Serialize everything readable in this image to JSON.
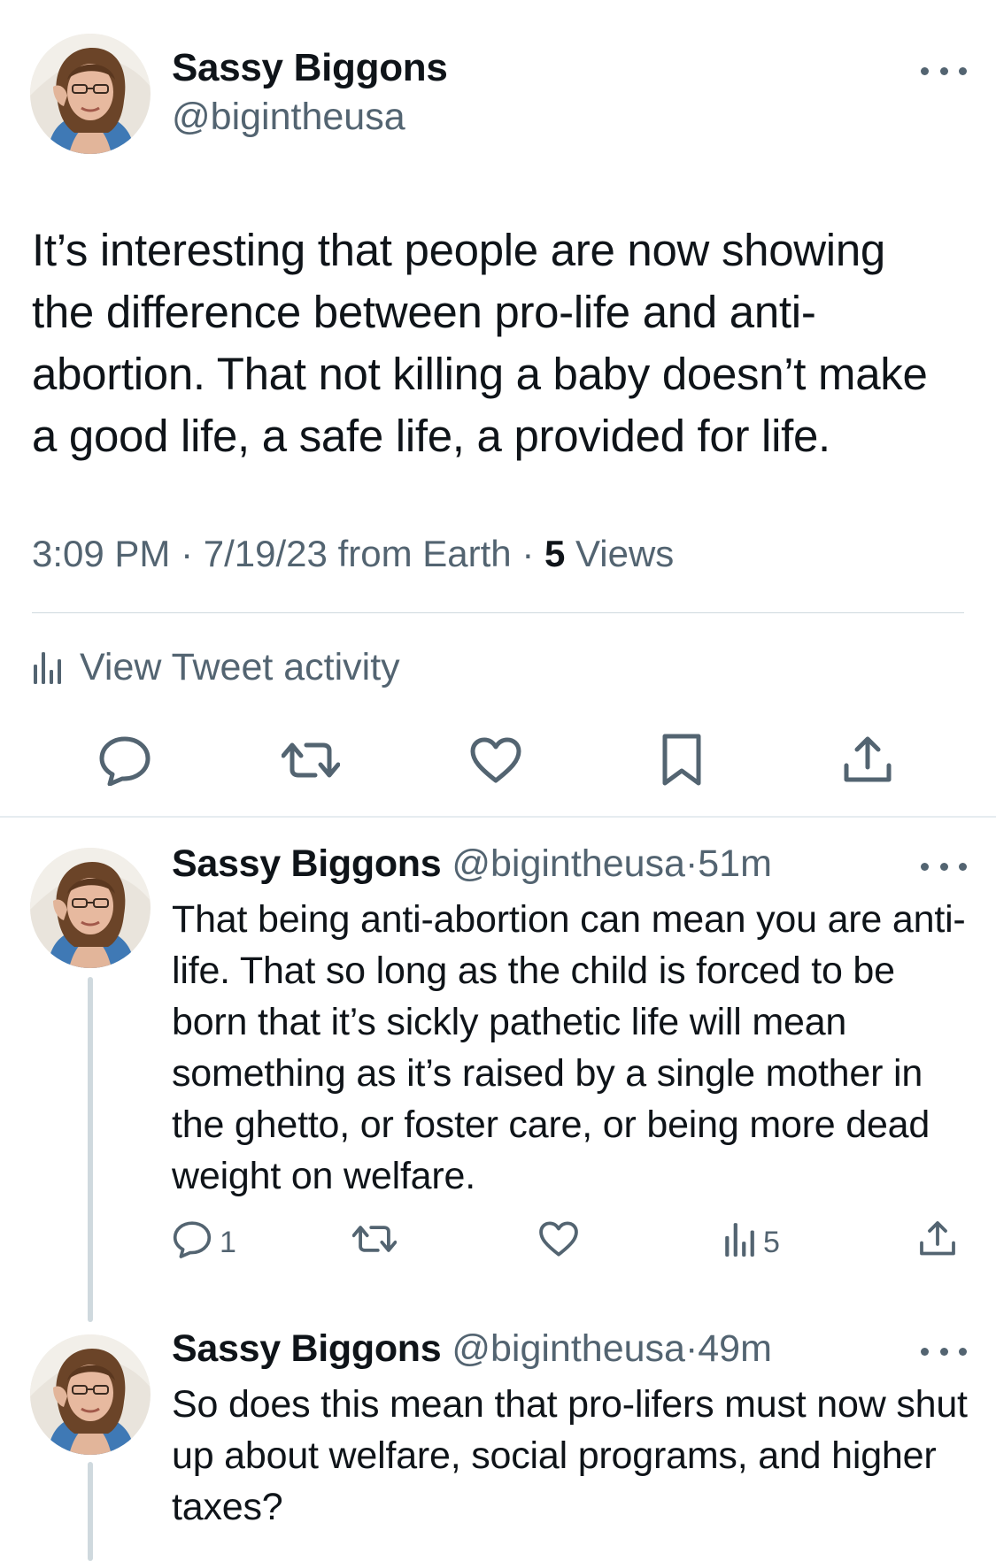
{
  "main_tweet": {
    "author_name": "Sassy Biggons",
    "author_handle": "@bigintheusa",
    "text": "It’s interesting that people are now showing\nthe difference between pro-life and anti-\nabortion. That not killing a baby doesn’t make\na good life, a safe life, a  provided for life.",
    "time": "3:09 PM",
    "date": "7/19/23",
    "source": "from Earth",
    "views_count": "5",
    "views_label": "Views",
    "activity_label": "View Tweet activity",
    "actions": [
      "reply-icon",
      "retweet-icon",
      "like-icon",
      "bookmark-icon",
      "share-icon"
    ]
  },
  "replies": [
    {
      "author_name": "Sassy Biggons",
      "author_handle": "@bigintheusa",
      "time": "51m",
      "text": "That being anti-abortion can mean you are anti-life. That so long as the child is forced to be born that it’s sickly pathetic life will mean something as it’s raised by a single mother in the ghetto, or foster care, or being more dead weight on welfare.",
      "reply_count": "1",
      "views_count": "5"
    },
    {
      "author_name": "Sassy Biggons",
      "author_handle": "@bigintheusa",
      "time": "49m",
      "text": "So does this mean that pro-lifers must now shut up about welfare, social programs, and higher taxes?"
    }
  ],
  "colors": {
    "text": "#0f1419",
    "secondary": "#536471",
    "divider": "#cfd9de",
    "background": "#ffffff"
  },
  "separator": "·"
}
